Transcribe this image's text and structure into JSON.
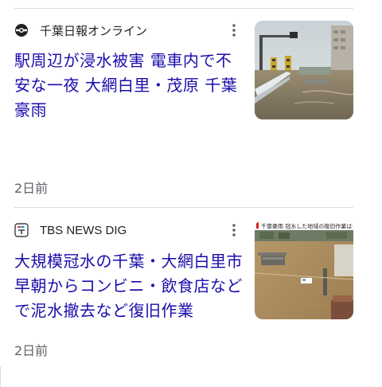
{
  "articles": [
    {
      "source": "千葉日報オンライン",
      "source_icon": "chiba-nippo-logo-icon",
      "headline": "駅周辺が浸水被害 電車内で不安な一夜 大網白里・茂原 千葉豪雨",
      "time": "2日前",
      "thumbnail": "flooded-street-photo"
    },
    {
      "source": "TBS NEWS DIG",
      "source_icon": "tbs-news-dig-logo-icon",
      "headline": "大規模冠水の千葉・大網白里市 早朝からコンビニ・飲食店などで泥水撤去など復旧作業",
      "time": "2日前",
      "thumbnail": "aerial-flood-video-frame",
      "thumbnail_caption": "千葉豪雨 冠水した地域の復旧作業は"
    }
  ],
  "icons": {
    "more": "more-vert-icon"
  },
  "colors": {
    "headline": "#1a0dab",
    "meta": "#5f6368",
    "divider": "#dadce0",
    "caption_red": "#d22222"
  }
}
